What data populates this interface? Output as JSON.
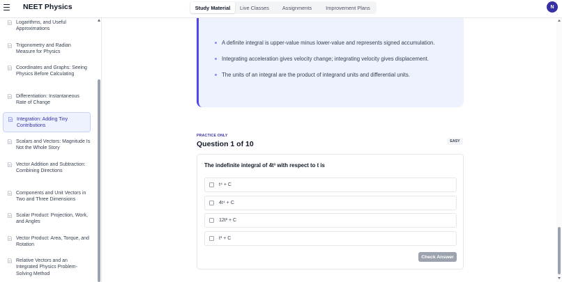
{
  "header": {
    "brand": "NEET Physics",
    "tabs": [
      {
        "label": "Study Material",
        "active": true
      },
      {
        "label": "Live Classes",
        "active": false
      },
      {
        "label": "Assignments",
        "active": false
      },
      {
        "label": "Improvement Plans",
        "active": false
      }
    ],
    "avatar_initial": "N",
    "avatar_color": "#3730a3"
  },
  "sidebar": {
    "items": [
      {
        "label": "Logarithms, and Useful Approximations",
        "icon": "document-icon"
      },
      {
        "label": "Trigonometry and Radian Measure for Physics",
        "icon": "document-icon"
      },
      {
        "label": "Coordinates and Graphs: Seeing Physics Before Calculating",
        "icon": "document-icon"
      },
      {
        "label": "Differentiation: Instantaneous Rate of Change",
        "icon": "document-icon"
      },
      {
        "label": "Integration: Adding Tiny Contributions",
        "icon": "document-icon",
        "active": true
      },
      {
        "label": "Scalars and Vectors: Magnitude Is Not the Whole Story",
        "icon": "document-icon"
      },
      {
        "label": "Vector Addition and Subtraction: Combining Directions",
        "icon": "document-icon"
      },
      {
        "label": "Components and Unit Vectors in Two and Three Dimensions",
        "icon": "document-icon"
      },
      {
        "label": "Scalar Product: Projection, Work, and Angles",
        "icon": "document-icon"
      },
      {
        "label": "Vector Product: Area, Torque, and Rotation",
        "icon": "document-icon"
      },
      {
        "label": "Relative Vectors and an Integrated Physics Problem-Solving Method",
        "icon": "document-icon"
      }
    ]
  },
  "reading": {
    "bullets": [
      "A definite integral is upper-value minus lower-value and represents signed accumulation.",
      "Integrating acceleration gives velocity change; integrating velocity gives displacement.",
      "The units of an integral are the product of integrand units and differential units."
    ]
  },
  "question": {
    "tag": "PRACTICE ONLY",
    "title": "Question 1 of 10",
    "difficulty": "EASY",
    "text": "The indefinite integral of 4t³ with respect to t is",
    "options": [
      "t⁴ + C",
      "4t⁴ + C",
      "12t² + C",
      "t³ + C"
    ],
    "check_label": "Check Answer"
  },
  "colors": {
    "accent": "#4f46e5",
    "card_bg": "#eef2ff",
    "button_disabled": "#9ca3af"
  }
}
